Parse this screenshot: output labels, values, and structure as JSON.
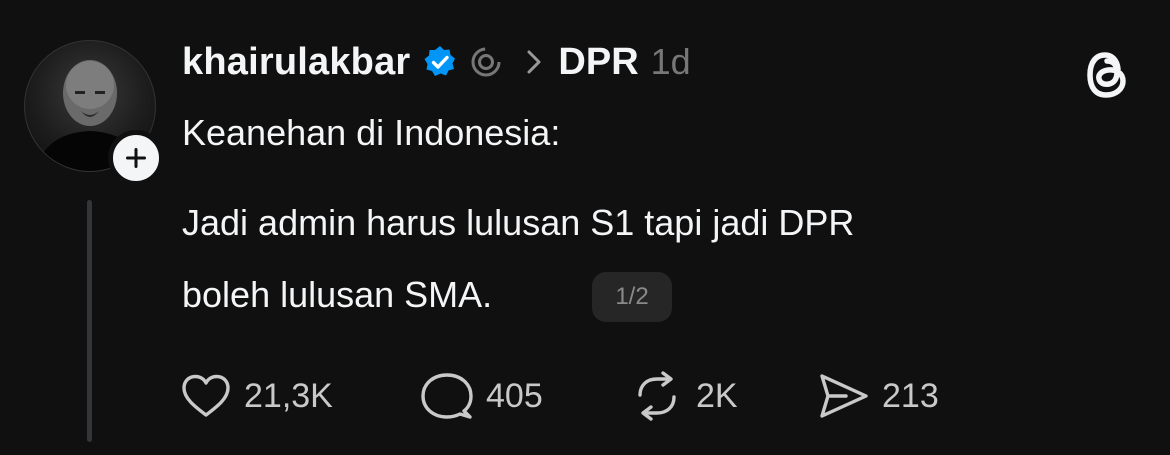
{
  "post": {
    "username": "khairulakbar",
    "topic": "DPR",
    "time": "1d",
    "text_line1": "Keanehan di Indonesia:",
    "text_line2": "Jadi admin harus lulusan S1 tapi jadi DPR",
    "text_line3": "boleh lulusan SMA.",
    "page_indicator": "1/2"
  },
  "actions": {
    "likes": "21,3K",
    "replies": "405",
    "reposts": "2K",
    "shares": "213"
  },
  "icons": {
    "verified": "verified-badge-icon",
    "thread": "thread-activity-icon",
    "chevron": "chevron-right-icon",
    "threads_logo": "threads-logo-icon",
    "like": "heart-icon",
    "reply": "comment-icon",
    "repost": "repost-icon",
    "share": "send-icon",
    "follow": "plus-icon"
  },
  "colors": {
    "background": "#101010",
    "text_primary": "#f3f5f7",
    "text_secondary": "#777777",
    "verified_blue": "#0095f6"
  }
}
